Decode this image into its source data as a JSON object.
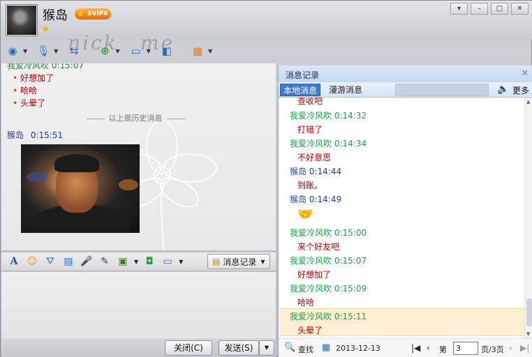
{
  "header": {
    "contact_name": "猴岛",
    "vip_badge": "SVIP6",
    "background_text": [
      "nick",
      "me"
    ]
  },
  "window_buttons": [
    "▾",
    "–",
    "□",
    "✕"
  ],
  "toolbar_icons": [
    "video-icon",
    "voice-icon",
    "transfer-file-icon",
    "add-contact-icon",
    "remote-desktop-icon",
    "share-screen-icon",
    "apps-icon"
  ],
  "chat": {
    "history_sender": "我爱冷风吹  0:15:07",
    "history_lines": [
      "好想加了",
      "哈哈",
      "头晕了"
    ],
    "history_divider": "以上是历史消息",
    "message_sender": "猴岛",
    "message_time": "0:15:51"
  },
  "format_toolbar": {
    "icons": [
      "font-icon",
      "emoji-icon",
      "shake-icon",
      "screenshot-icon",
      "voice-message-icon",
      "note-icon",
      "image-icon",
      "pic-icon",
      "screen-icon"
    ],
    "message_record_label": "消息记录"
  },
  "buttons": {
    "close_label": "关闭(C)",
    "send_label": "发送(S)"
  },
  "history_panel": {
    "title": "消息记录",
    "tab_local": "本地消息",
    "tab_roaming": "漫游消息",
    "more_label": "更多",
    "entries": [
      {
        "type": "text",
        "text": "查收吧"
      },
      {
        "type": "sender",
        "name": "我爱冷风吹",
        "time": "0:14:32",
        "color": "green"
      },
      {
        "type": "text",
        "text": "打错了"
      },
      {
        "type": "sender",
        "name": "我爱冷风吹",
        "time": "0:14:34",
        "color": "green"
      },
      {
        "type": "text",
        "text": "不好意思"
      },
      {
        "type": "sender",
        "name": "猴岛",
        "time": "0:14:44",
        "color": "blue"
      },
      {
        "type": "text",
        "text": "到账。",
        "dark": true
      },
      {
        "type": "sender",
        "name": "猴岛",
        "time": "0:14:49",
        "color": "blue"
      },
      {
        "type": "emoji",
        "text": "🤝"
      },
      {
        "type": "sender",
        "name": "我爱冷风吹",
        "time": "0:15:00",
        "color": "green"
      },
      {
        "type": "text",
        "text": "来个好友吧"
      },
      {
        "type": "sender",
        "name": "我爱冷风吹",
        "time": "0:15:07",
        "color": "green"
      },
      {
        "type": "text",
        "text": "好想加了"
      },
      {
        "type": "sender",
        "name": "我爱冷风吹",
        "time": "0:15:09",
        "color": "green"
      },
      {
        "type": "text",
        "text": "哈哈"
      },
      {
        "type": "sender",
        "name": "我爱冷风吹",
        "time": "0:15:11",
        "color": "green"
      },
      {
        "type": "text",
        "text": "头晕了"
      }
    ],
    "footer": {
      "search_label": "查找",
      "date": "2013-12-13",
      "page_prefix": "第",
      "current_page": "3",
      "page_suffix": "页/3页"
    }
  }
}
